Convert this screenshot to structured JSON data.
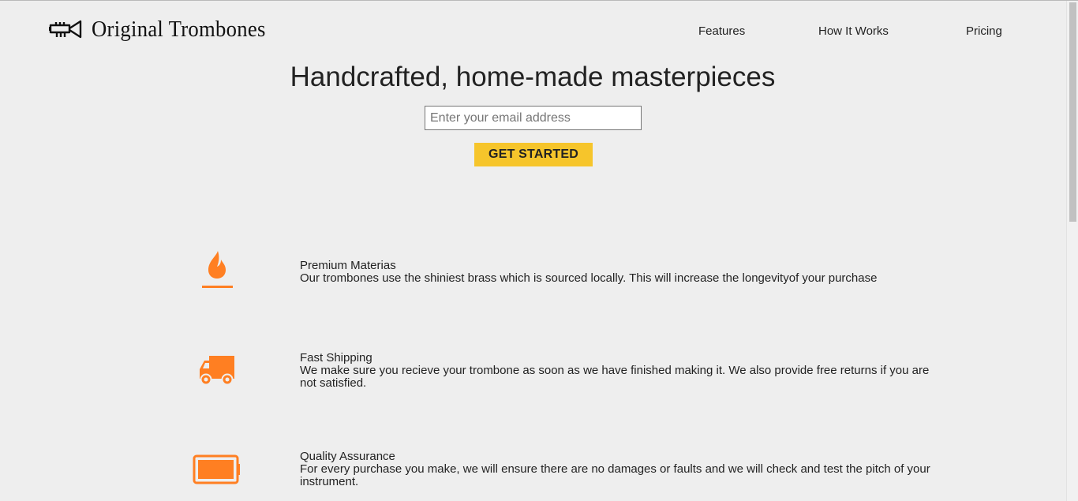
{
  "header": {
    "logo_text": "Original Trombones",
    "logo_icon": "trumpet-icon",
    "nav": [
      {
        "label": "Features"
      },
      {
        "label": "How It Works"
      },
      {
        "label": "Pricing"
      }
    ]
  },
  "hero": {
    "title": "Handcrafted, home-made masterpieces",
    "email_placeholder": "Enter your email address",
    "email_value": "",
    "cta_label": "GET STARTED"
  },
  "features": [
    {
      "icon": "fire-icon",
      "title": "Premium Materias",
      "description": "Our trombones use the shiniest brass which is sourced locally. This will increase the longevityof your purchase"
    },
    {
      "icon": "truck-icon",
      "title": "Fast Shipping",
      "description": "We make sure you recieve your trombone as soon as we have finished making it. We also provide free returns if you are not satisfied."
    },
    {
      "icon": "battery-icon",
      "title": "Quality Assurance",
      "description": "For every purchase you make, we will ensure there are no damages or faults and we will check and test the pitch of your instrument."
    }
  ],
  "colors": {
    "accent": "#f6c52b",
    "icon": "#ff7f22",
    "background": "#eeeeee"
  }
}
